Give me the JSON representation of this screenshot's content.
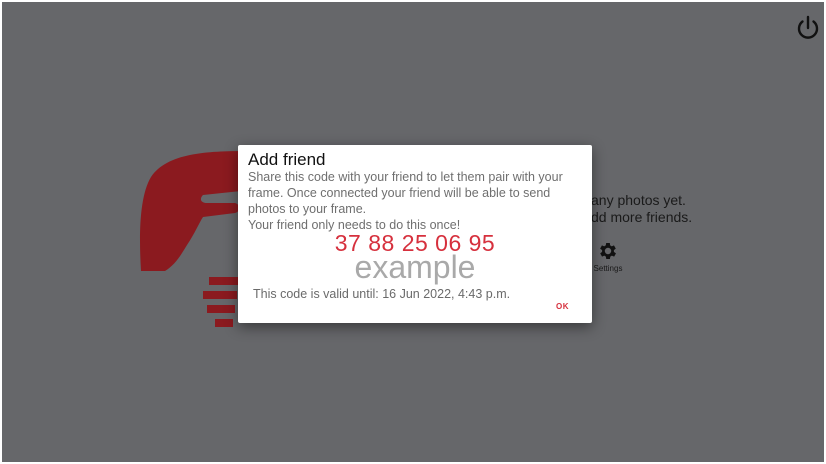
{
  "background": {
    "message_line1": "any photos yet.",
    "message_line2": "dd more friends.",
    "settings_label": "Settings",
    "icons": {
      "power": "power-icon",
      "settings": "gear-icon",
      "logo": "hands-logo"
    }
  },
  "dialog": {
    "title": "Add friend",
    "body_line1": "Share this code with your friend to let them pair with your frame. Once connected your friend will be able to send photos to your frame.",
    "body_line2": "Your friend only needs to do this once!",
    "code": "37 88 25 06 95",
    "watermark": "example",
    "valid_until": "This code is valid until: 16 Jun 2022, 4:43 p.m.",
    "ok_label": "OK"
  },
  "colors": {
    "overlay": "#66676a",
    "accent": "#d6303d",
    "logo": "#8b1a1f"
  }
}
